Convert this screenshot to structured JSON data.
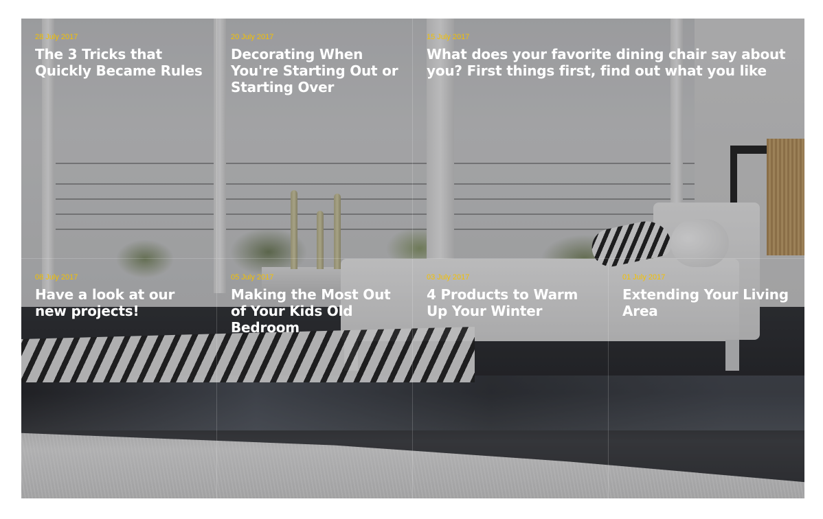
{
  "posts": [
    {
      "date": "28 July 2017",
      "title": "The 3 Tricks that Quickly Became Rules"
    },
    {
      "date": "20 July 2017",
      "title": "Decorating When You're Starting Out or Starting Over"
    },
    {
      "date": "15 July 2017",
      "title": "What does your favorite dining chair say about you? First things first, find out what you like"
    },
    {
      "date": "08 July 2017",
      "title": "Have a look at our new projects!"
    },
    {
      "date": "05 July 2017",
      "title": "Making the Most Out of Your Kids Old Bedroom"
    },
    {
      "date": "03 July 2017",
      "title": "4 Products to Warm Up Your Winter"
    },
    {
      "date": "01 July 2017",
      "title": "Extending Your Living Area"
    }
  ],
  "colors": {
    "date_accent": "#f4c100",
    "title_text": "#ffffff",
    "tile_divider": "rgba(255,255,255,0.18)"
  },
  "background_image": "living-room-photo"
}
